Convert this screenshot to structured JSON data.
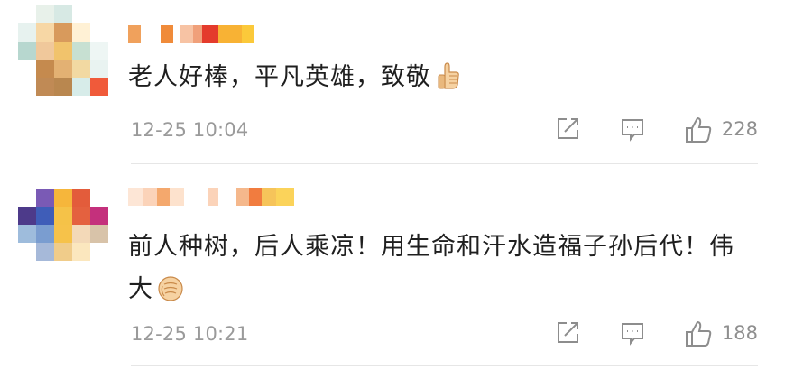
{
  "comments": [
    {
      "text": "老人好棒，平凡英雄，致敬",
      "emoji": "thumbs-up-emoji",
      "timestamp": "12-25 10:04",
      "like_count": "228",
      "avatar_colors": [
        "#ffffff",
        "#e8f1ea",
        "#d7e9e4",
        "#ffffff",
        "#ffffff",
        "#e7f2ef",
        "#f7d7a5",
        "#d89a5c",
        "#fff1d5",
        "#ffffff",
        "#b7d7cf",
        "#f0c89b",
        "#f1c36c",
        "#c7e0d2",
        "#eef6f4",
        "#ffffff",
        "#c58a4e",
        "#e3b173",
        "#f2d9a2",
        "#e9f3f1",
        "#ffffff",
        "#c08a55",
        "#b9874f",
        "#d7ece9",
        "#f05a3a"
      ],
      "username_blocks": [
        {
          "w": 14,
          "c": "#f0a15c"
        },
        {
          "w": 22,
          "c": "#ffffff"
        },
        {
          "w": 14,
          "c": "#f08b3a"
        },
        {
          "w": 8,
          "c": "#ffffff"
        },
        {
          "w": 14,
          "c": "#f7c3a4"
        },
        {
          "w": 10,
          "c": "#f0a07a"
        },
        {
          "w": 18,
          "c": "#e43b2c"
        },
        {
          "w": 26,
          "c": "#f8b234"
        },
        {
          "w": 14,
          "c": "#fbc93a"
        }
      ]
    },
    {
      "text": "前人种树，后人乘凉！用生命和汗水造福子孙后代！伟大",
      "emoji": "fist-emoji",
      "timestamp": "12-25 10:21",
      "like_count": "188",
      "avatar_colors": [
        "#ffffff",
        "#7a5ab5",
        "#f6b63b",
        "#e35c3b",
        "#ffffff",
        "#4d3a8a",
        "#3f5db8",
        "#f5c248",
        "#e4613f",
        "#c4307c",
        "#9ebcdc",
        "#7a9dd0",
        "#f6c24a",
        "#f3d9b8",
        "#d8c3a9",
        "#ffffff",
        "#a6b9d9",
        "#f0cc8a",
        "#fbe7be",
        "#ffffff",
        "#ffffff",
        "#ffffff",
        "#ffffff",
        "#ffffff",
        "#ffffff"
      ],
      "username_blocks": [
        {
          "w": 16,
          "c": "#fde6d6"
        },
        {
          "w": 16,
          "c": "#fbd3b9"
        },
        {
          "w": 14,
          "c": "#f4a86d"
        },
        {
          "w": 16,
          "c": "#fde2cd"
        },
        {
          "w": 26,
          "c": "#ffffff"
        },
        {
          "w": 12,
          "c": "#fbd3b9"
        },
        {
          "w": 20,
          "c": "#ffffff"
        },
        {
          "w": 14,
          "c": "#f5b88c"
        },
        {
          "w": 14,
          "c": "#f17c3f"
        },
        {
          "w": 16,
          "c": "#f6c45a"
        },
        {
          "w": 20,
          "c": "#fbd35a"
        }
      ]
    }
  ],
  "icons": {
    "share": "share-icon",
    "comment": "comment-icon",
    "like": "thumbs-up-icon"
  },
  "colors": {
    "meta_text": "#9a9a9a",
    "icon_stroke": "#8d8d8d",
    "divider": "#e6e6e6"
  }
}
